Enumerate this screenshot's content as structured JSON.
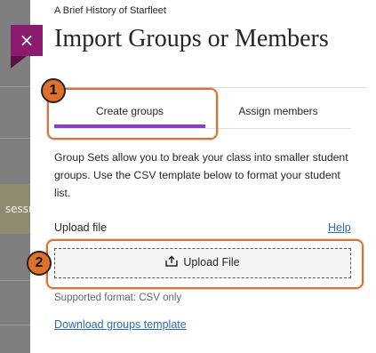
{
  "background": {
    "row_text": "sessr"
  },
  "panel": {
    "course_name": "A Brief History of Starfleet",
    "title": "Import Groups or Members",
    "close_glyph": "×",
    "tabs": [
      {
        "label": "Create groups",
        "selected": true
      },
      {
        "label": "Assign members",
        "selected": false
      }
    ],
    "description": "Group Sets allow you to break your class into smaller student groups. Use the CSV template below to format your student list.",
    "upload_label": "Upload file",
    "help_link": "Help",
    "upload_button": "Upload File",
    "supported_format": "Supported format: CSV only",
    "download_link": "Download groups template"
  },
  "annotations": [
    {
      "number": "1"
    },
    {
      "number": "2"
    }
  ],
  "colors": {
    "accent": "#8a3ec8",
    "close_tab": "#8a1b6e",
    "annotation": "#e0702a",
    "link": "#2b6cb0"
  },
  "icons": {
    "close": "close-icon",
    "upload": "upload-icon"
  }
}
